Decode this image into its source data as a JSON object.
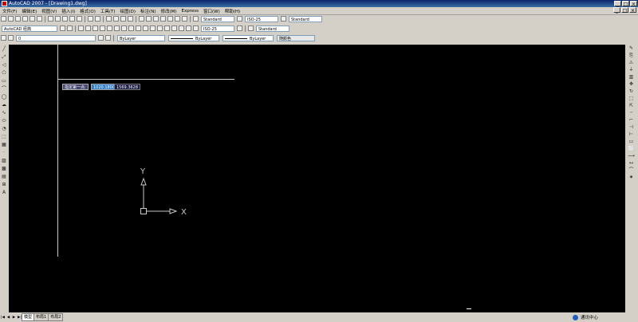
{
  "window": {
    "title": "AutoCAD 2007 - [Drawing1.dwg]",
    "buttons": [
      "_",
      "□",
      "×"
    ]
  },
  "menu": {
    "items": [
      "文件(F)",
      "编辑(E)",
      "视图(V)",
      "插入(I)",
      "格式(O)",
      "工具(T)",
      "绘图(D)",
      "标注(N)",
      "修改(M)",
      "Express",
      "窗口(W)",
      "帮助(H)"
    ]
  },
  "toolbar1": {
    "text_style": "Standard",
    "dim_style": "ISO-25",
    "table_style": "Standard"
  },
  "toolbar2": {
    "workspace": "AutoCAD 经典",
    "dim_style2": "ISO-25",
    "table_style2": "Standard"
  },
  "toolbar3": {
    "layer": "0",
    "color": "ByLayer",
    "linetype": "ByLayer",
    "lineweight": "ByLayer",
    "plot_style": "随颜色"
  },
  "left_tools": [
    "╱",
    "⤢",
    "◁",
    "⬠",
    "▭",
    "⌒",
    "◯",
    "☁",
    "∿",
    "⬭",
    "◔",
    "⬚",
    "▦",
    "·",
    "▨",
    "▩",
    "▤",
    "⊞",
    "A"
  ],
  "right_tools": [
    "✎",
    "⎘",
    "⚠",
    "⏚",
    "▥",
    "✥",
    "↻",
    "⬚",
    "⇱",
    "┄",
    "⌐",
    "⊣",
    "⊢",
    "▭",
    "⬜",
    "⟶",
    "↤",
    "⌒",
    "✷"
  ],
  "dynamic_input": {
    "prompt": "指定第一点:",
    "x_value": "1020.1800",
    "y_value": "1569.3628"
  },
  "ucs": {
    "x_label": "X",
    "y_label": "Y"
  },
  "layout_tabs": {
    "nav": [
      "|◀",
      "◀",
      "▶",
      "▶|"
    ],
    "model": "模型",
    "layout1": "布局1",
    "layout2": "布局2"
  },
  "comm_center": {
    "label": "通讯中心"
  },
  "colors": {
    "canvas": "#000000",
    "chrome": "#d4d0c8",
    "titlebar": "#0a246a",
    "dyn_highlight": "#2e7cc8"
  }
}
